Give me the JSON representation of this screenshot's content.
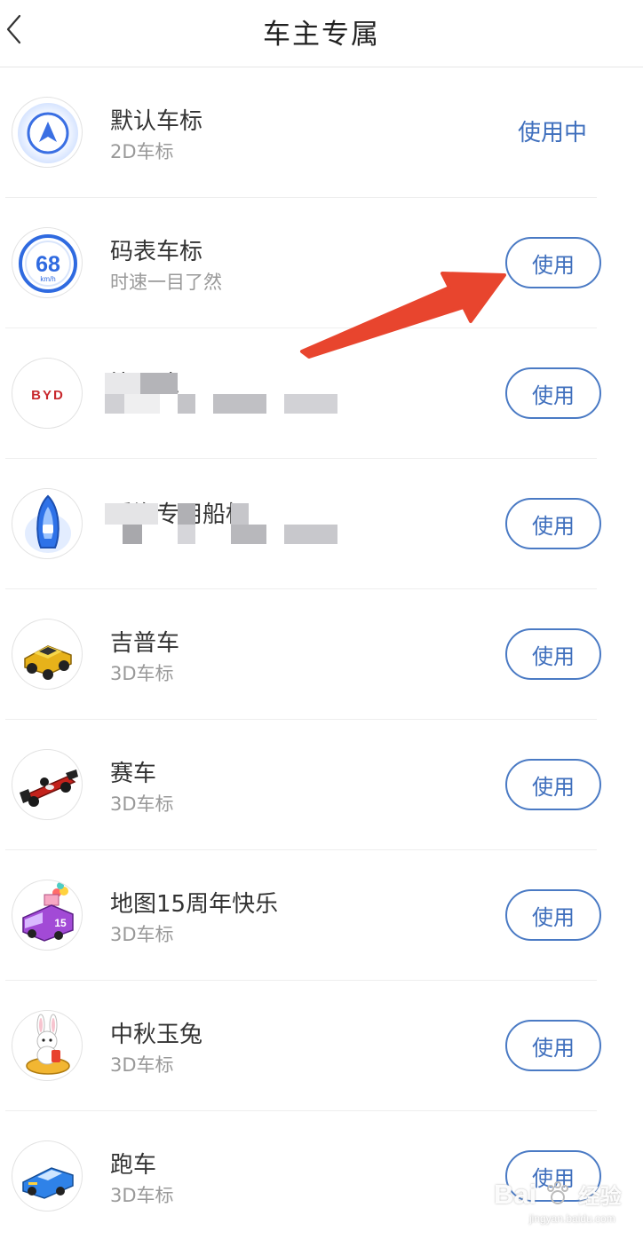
{
  "header": {
    "title": "车主专属",
    "back_icon": "chevron-left-icon"
  },
  "accent_color": "#3f6fbd",
  "items": [
    {
      "name": "默认车标",
      "sub": "2D车标",
      "status": "使用中",
      "icon": "navigation-arrow-icon"
    },
    {
      "name": "码表车标",
      "sub": "时速一目了然",
      "button": "使用",
      "icon": "speedometer-icon",
      "icon_number": "68",
      "icon_unit": "km/h"
    },
    {
      "name": "比亚迪",
      "sub": "",
      "button": "使用",
      "icon": "byd-logo-icon",
      "icon_text": "BYD"
    },
    {
      "name": "看海专用船标",
      "sub": "",
      "button": "使用",
      "icon": "boat-icon"
    },
    {
      "name": "吉普车",
      "sub": "3D车标",
      "button": "使用",
      "icon": "jeep-icon"
    },
    {
      "name": "赛车",
      "sub": "3D车标",
      "button": "使用",
      "icon": "race-car-icon"
    },
    {
      "name": "地图15周年快乐",
      "sub": "3D车标",
      "button": "使用",
      "icon": "anniversary-van-icon",
      "icon_number": "15"
    },
    {
      "name": "中秋玉兔",
      "sub": "3D车标",
      "button": "使用",
      "icon": "moon-rabbit-icon"
    },
    {
      "name": "跑车",
      "sub": "3D车标",
      "button": "使用",
      "icon": "sports-car-icon"
    }
  ],
  "watermark": {
    "brand": "Bai",
    "brand_suffix": "经验",
    "url": "jingyan.baidu.com"
  }
}
